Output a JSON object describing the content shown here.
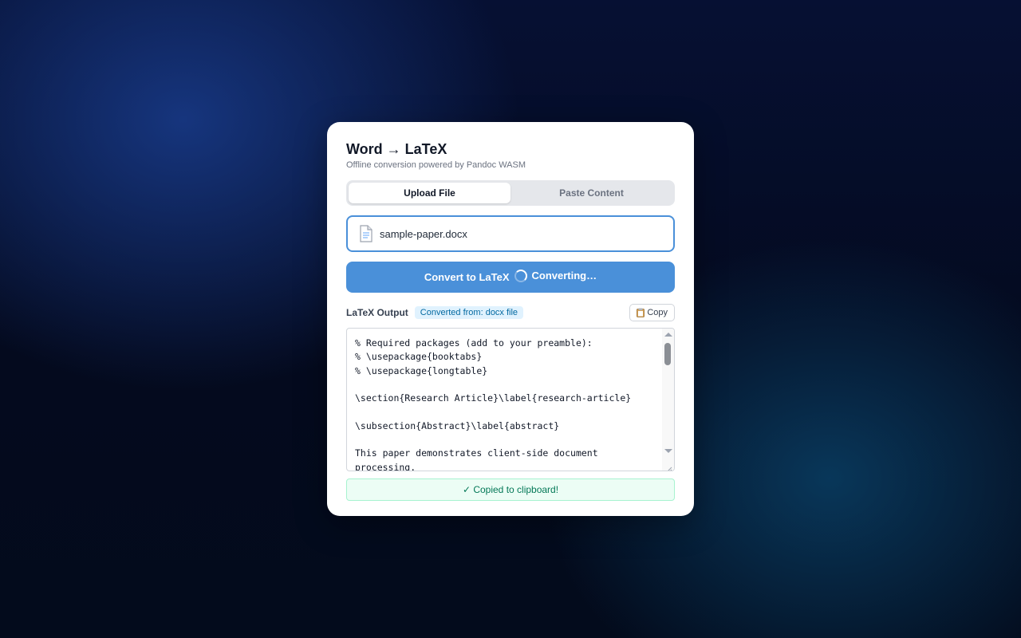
{
  "app": {
    "title": "Word → LaTeX",
    "subtitle": "Offline conversion powered by Pandoc WASM"
  },
  "tabs": [
    {
      "label": "Upload File",
      "active": true
    },
    {
      "label": "Paste Content",
      "active": false
    }
  ],
  "upload": {
    "file_icon": "document-icon",
    "file_name": "sample-paper.docx"
  },
  "convert": {
    "label": "Convert to LaTeX",
    "status_label": "Converting…"
  },
  "output": {
    "label": "LaTeX Output",
    "source_badge": "Converted from: docx file",
    "copy_icon": "clipboard-icon",
    "copy_label": "Copy",
    "text": "% Required packages (add to your preamble):\n% \\usepackage{booktabs}\n% \\usepackage{longtable}\n\n\\section{Research Article}\\label{research-article}\n\n\\subsection{Abstract}\\label{abstract}\n\nThis paper demonstrates client-side document\nprocessing."
  },
  "status": {
    "message": "✓ Copied to clipboard!"
  },
  "colors": {
    "accent": "#4a90d9",
    "success_bg": "#ecfdf5",
    "success_text": "#047857",
    "badge_bg": "#e0f2fe",
    "badge_text": "#0369a1"
  }
}
